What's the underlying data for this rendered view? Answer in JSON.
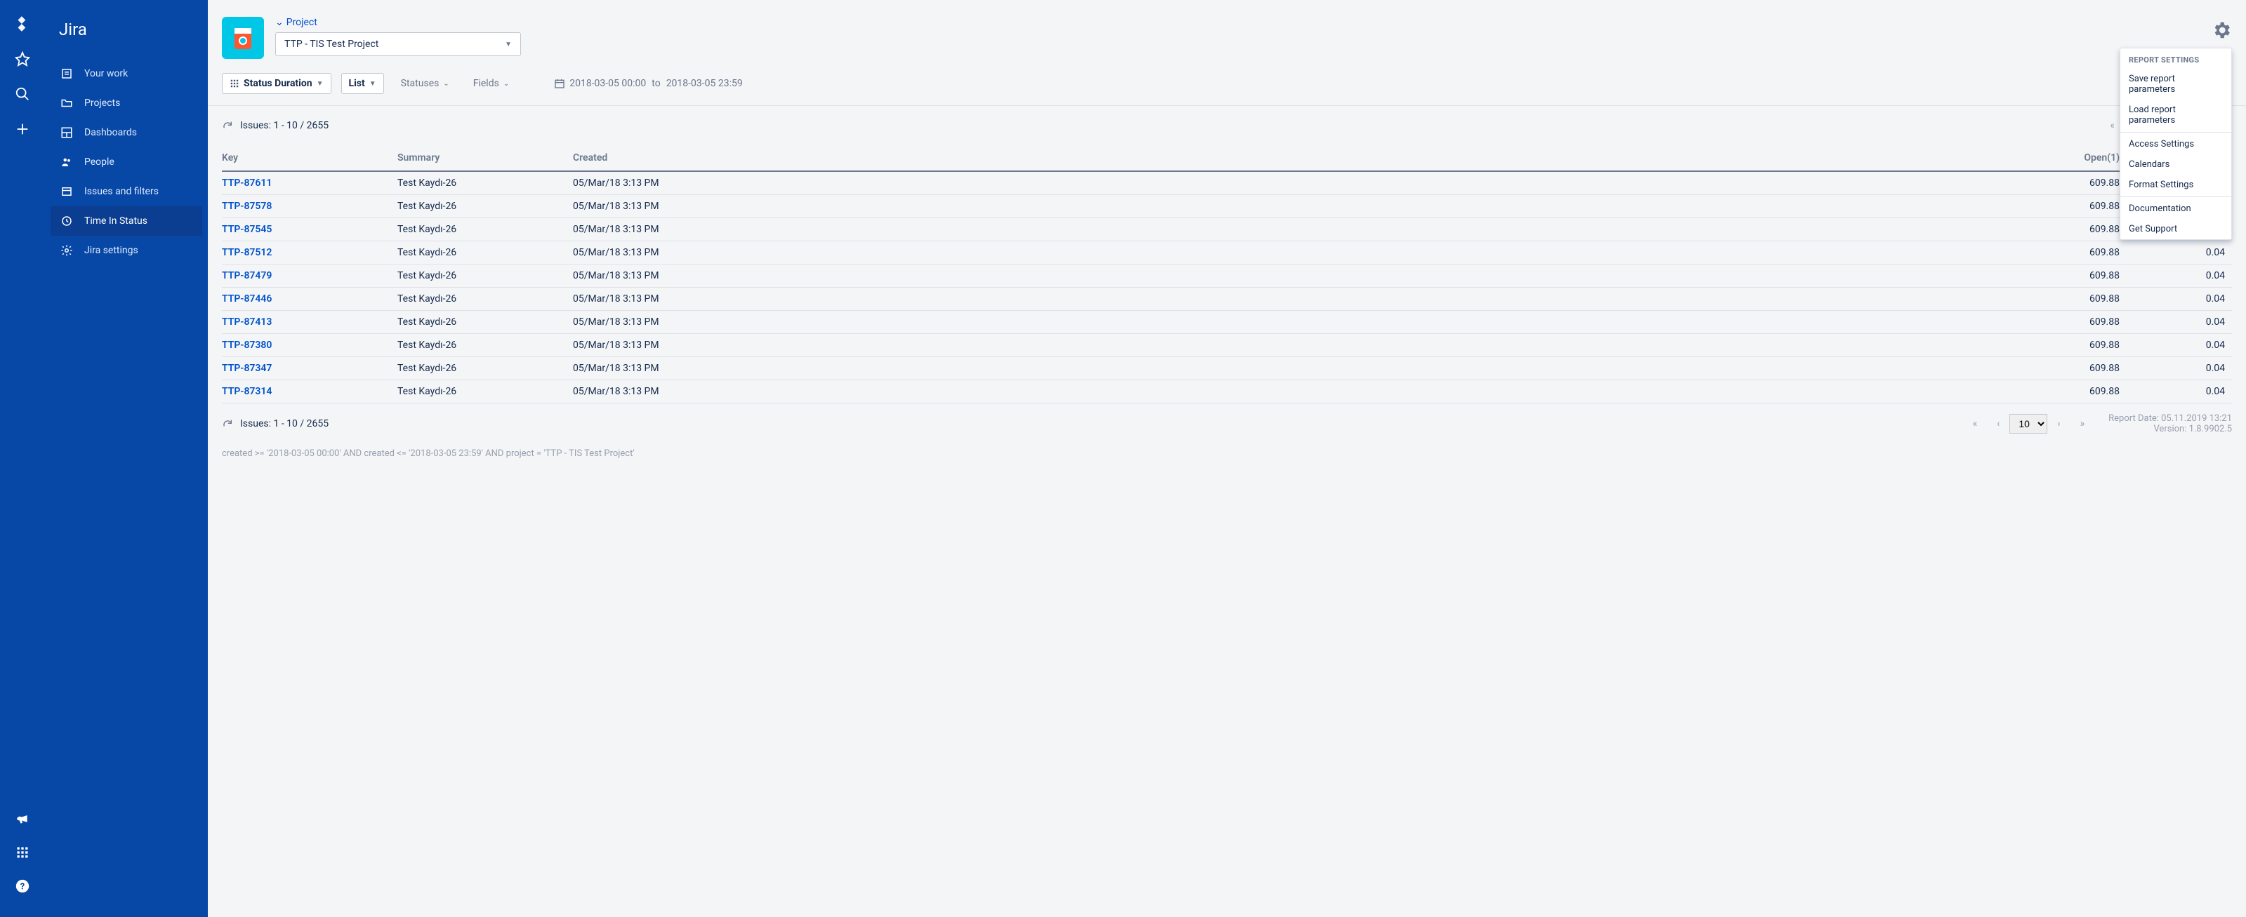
{
  "app_title": "Jira",
  "sidebar": {
    "items": [
      {
        "label": "Your work"
      },
      {
        "label": "Projects"
      },
      {
        "label": "Dashboards"
      },
      {
        "label": "People"
      },
      {
        "label": "Issues and filters"
      },
      {
        "label": "Time In Status"
      },
      {
        "label": "Jira settings"
      }
    ]
  },
  "project": {
    "breadcrumb_caret": "⌄",
    "breadcrumb": "Project",
    "select_value": "TTP - TIS Test Project"
  },
  "toolbar": {
    "status_duration": "Status Duration",
    "list": "List",
    "statuses": "Statuses",
    "fields": "Fields",
    "date_from": "2018-03-05 00:00",
    "date_to_lbl": "to",
    "date_to": "2018-03-05 23:59",
    "calendar": "Calendar"
  },
  "pager": {
    "issues_text": "Issues: 1 - 10 / 2655",
    "page_size": "10"
  },
  "table": {
    "headers": {
      "key": "Key",
      "summary": "Summary",
      "created": "Created",
      "open": "Open(1)"
    },
    "rows": [
      {
        "key": "TTP-87611",
        "summary": "Test Kaydı-26",
        "created": "05/Mar/18 3:13 PM",
        "open": "609.88",
        "last": ""
      },
      {
        "key": "TTP-87578",
        "summary": "Test Kaydı-26",
        "created": "05/Mar/18 3:13 PM",
        "open": "609.88",
        "last": "0.04"
      },
      {
        "key": "TTP-87545",
        "summary": "Test Kaydı-26",
        "created": "05/Mar/18 3:13 PM",
        "open": "609.88",
        "last": "0.04"
      },
      {
        "key": "TTP-87512",
        "summary": "Test Kaydı-26",
        "created": "05/Mar/18 3:13 PM",
        "open": "609.88",
        "last": "0.04"
      },
      {
        "key": "TTP-87479",
        "summary": "Test Kaydı-26",
        "created": "05/Mar/18 3:13 PM",
        "open": "609.88",
        "last": "0.04"
      },
      {
        "key": "TTP-87446",
        "summary": "Test Kaydı-26",
        "created": "05/Mar/18 3:13 PM",
        "open": "609.88",
        "last": "0.04"
      },
      {
        "key": "TTP-87413",
        "summary": "Test Kaydı-26",
        "created": "05/Mar/18 3:13 PM",
        "open": "609.88",
        "last": "0.04"
      },
      {
        "key": "TTP-87380",
        "summary": "Test Kaydı-26",
        "created": "05/Mar/18 3:13 PM",
        "open": "609.88",
        "last": "0.04"
      },
      {
        "key": "TTP-87347",
        "summary": "Test Kaydı-26",
        "created": "05/Mar/18 3:13 PM",
        "open": "609.88",
        "last": "0.04"
      },
      {
        "key": "TTP-87314",
        "summary": "Test Kaydı-26",
        "created": "05/Mar/18 3:13 PM",
        "open": "609.88",
        "last": "0.04"
      }
    ]
  },
  "dropdown": {
    "header": "REPORT SETTINGS",
    "group1": [
      "Save report parameters",
      "Load report parameters"
    ],
    "group2": [
      "Access Settings",
      "Calendars",
      "Format Settings"
    ],
    "group3": [
      "Documentation",
      "Get Support"
    ]
  },
  "footer": {
    "query": "created >= '2018-03-05 00:00' AND created <= '2018-03-05 23:59' AND project = 'TTP - TIS Test Project'",
    "report_date": "Report Date: 05.11.2019 13:21",
    "version": "Version: 1.8.9902.5"
  }
}
